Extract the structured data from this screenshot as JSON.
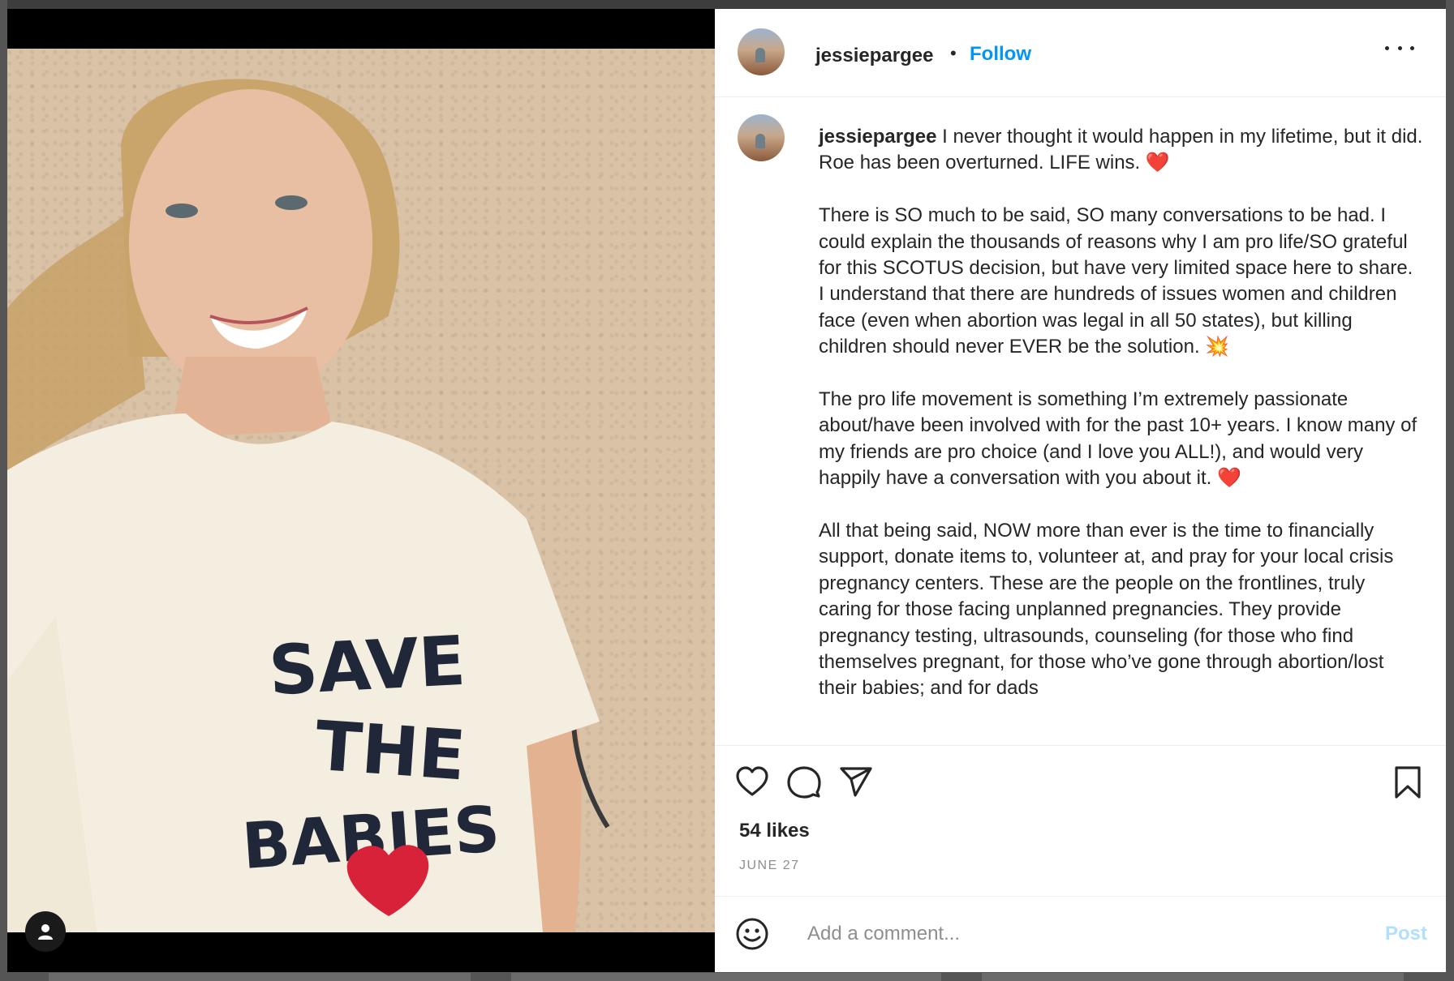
{
  "post": {
    "username": "jessiepargee",
    "separator": "•",
    "follow_label": "Follow",
    "caption_paragraphs": [
      " I never thought it would happen in my lifetime, but it did. Roe has been overturned. LIFE wins. ",
      "There is SO much to be said, SO many conversations to be had. I could explain the thousands of reasons why I am pro life/SO grateful for this SCOTUS decision, but have very limited space here to share. I understand that there are hundreds of issues women and children face (even when abortion was legal in all 50 states), but killing children should never EVER be the solution. ",
      "The pro life movement is something I’m extremely passionate about/have been involved with for the past 10+ years. I know many of my friends are pro choice (and I love you ALL!), and would very happily have a conversation with you about it. ",
      "All that being said, NOW more than ever is the time to financially support, donate items to, volunteer at, and pray for your local crisis pregnancy centers. These are the people on the frontlines, truly caring for those facing unplanned pregnancies. They provide pregnancy testing, ultrasounds, counseling (for those who find themselves pregnant, for those who’ve gone through abortion/lost their babies; and for dads"
    ],
    "emoji_heart": "❤️",
    "emoji_boom": "💥",
    "likes": "54 likes",
    "date": "JUNE 27"
  },
  "comment": {
    "placeholder": "Add a comment...",
    "post_label": "Post"
  },
  "icons": {
    "like": "heart-icon",
    "comment": "comment-icon",
    "share": "send-icon",
    "save": "bookmark-icon",
    "emoji": "smiley-icon",
    "more": "more-icon",
    "tags": "user-tag-icon"
  },
  "colors": {
    "accent": "#0095f6",
    "post_disabled": "#b2dffc",
    "muted": "#8e8e8e"
  }
}
